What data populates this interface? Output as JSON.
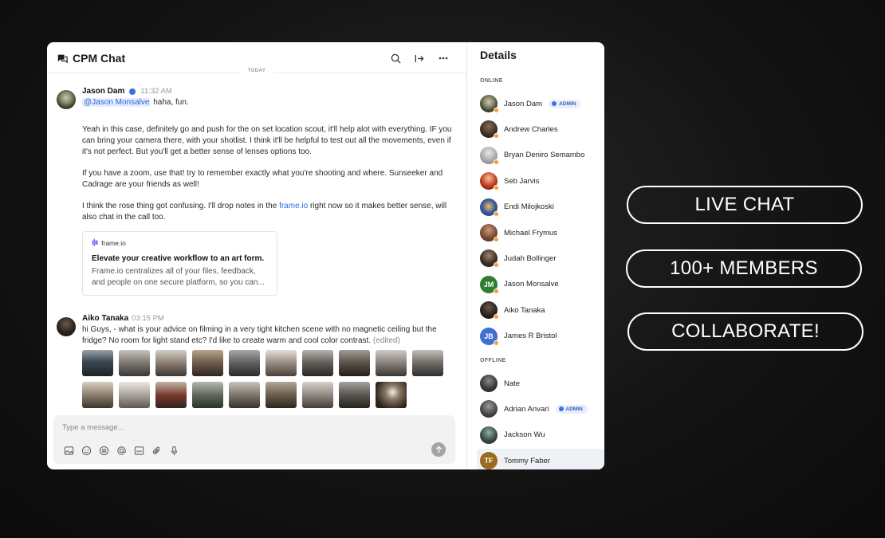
{
  "chat": {
    "title": "CPM Chat",
    "divider": "TODAY",
    "messages": [
      {
        "name": "Jason Dam",
        "time": "11:32 AM",
        "mention": "@Jason Monsalve",
        "first": " haha, fun.",
        "p1": "Yeah in this case, definitely go and push for the on set location scout, it'll help alot with everything. IF you can bring your camera there, with your shotlist. I think it'll be helpful to test out all the movements, even if it's not perfect. But you'll get a better sense of lenses options too.",
        "p2": "If you have a zoom, use that! try to remember exactly what you're shooting and where. Sunseeker and Cadrage are your friends as well!",
        "p3a": "I think the rose thing got confusing. I'll drop notes in the ",
        "p3link": "frame.io",
        "p3b": " right now so it makes better sense, will also chat in the call too.",
        "preview": {
          "source": "frame.io",
          "title": "Elevate your creative workflow to an art form.",
          "desc": "Frame.io centralizes all of your files, feedback, and people on one secure platform, so you can..."
        }
      },
      {
        "name": "Aiko Tanaka",
        "time": "03:15 PM",
        "text": "hi Guys, - what is your advice on filming in a very tight kitchen scene with no magnetic ceiling but the fridge? No room for light stand etc? I'd like to create warm and cool color contrast.",
        "edited": "(edited)"
      }
    ],
    "composer_placeholder": "Type a message..."
  },
  "details": {
    "title": "Details",
    "online_label": "ONLINE",
    "offline_label": "OFFLINE",
    "admin_label": "ADMIN",
    "online": [
      {
        "name": "Jason Dam",
        "admin": true
      },
      {
        "name": "Andrew Charles"
      },
      {
        "name": "Bryan Deniro Semambo"
      },
      {
        "name": "Seb Jarvis"
      },
      {
        "name": "Endi Milojkoski"
      },
      {
        "name": "Michael Frymus"
      },
      {
        "name": "Judah Bollinger"
      },
      {
        "name": "Jason Monsalve",
        "initials": "JM",
        "color": "#2e7d32"
      },
      {
        "name": "Aiko Tanaka"
      },
      {
        "name": "James R Bristol",
        "initials": "JB",
        "color": "#3f6fd1"
      }
    ],
    "offline": [
      {
        "name": "Nate"
      },
      {
        "name": "Adrian Anvari",
        "admin": true
      },
      {
        "name": "Jackson Wu"
      },
      {
        "name": "Tommy Faber",
        "initials": "TF",
        "color": "#9a6b1e"
      }
    ]
  },
  "promo": {
    "pill1": "LIVE CHAT",
    "pill2": "100+ MEMBERS",
    "pill3": "COLLABORATE!"
  }
}
